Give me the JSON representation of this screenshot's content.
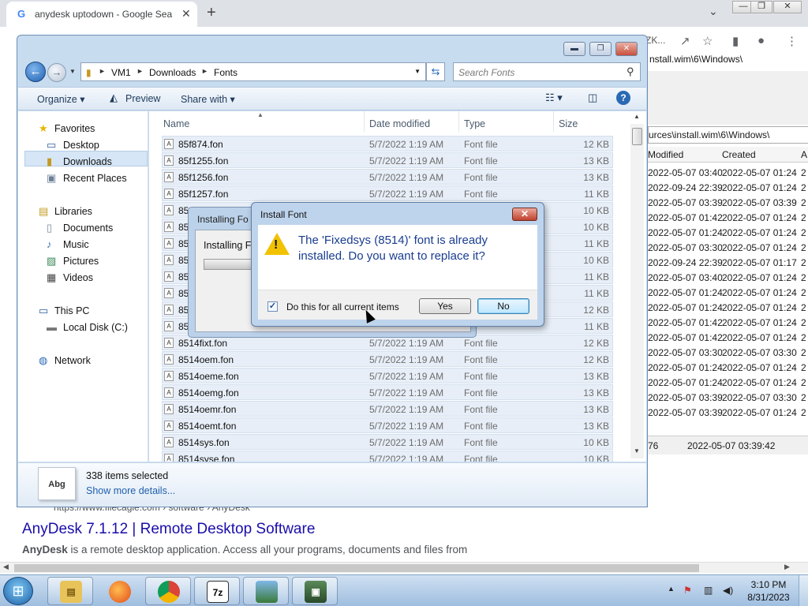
{
  "chrome": {
    "tab_title": "anydesk uptodown - Google Sea",
    "tab_close": "✕",
    "new_tab": "+",
    "tab_list": "⌄",
    "address_frag": "ZK...",
    "search_result": {
      "url": "https://www.filecagle.com › software › AnyDesk",
      "title": "AnyDesk 7.1.12 | Remote Desktop Software",
      "snippet_bold": "AnyDesk",
      "snippet": " is a remote desktop application. Access all your programs, documents and files from"
    }
  },
  "zip": {
    "path_top": "nstall.wim\\6\\Windows\\",
    "path": "urces\\install.wim\\6\\Windows\\",
    "columns": [
      "Modified",
      "Created",
      "A"
    ],
    "rows": [
      [
        "2022-05-07 03:40",
        "2022-05-07 01:24",
        "2"
      ],
      [
        "2022-09-24 22:39",
        "2022-05-07 01:24",
        "2"
      ],
      [
        "2022-05-07 03:39",
        "2022-05-07 03:39",
        "2"
      ],
      [
        "2022-05-07 01:42",
        "2022-05-07 01:24",
        "2"
      ],
      [
        "2022-05-07 01:24",
        "2022-05-07 01:24",
        "2"
      ],
      [
        "2022-05-07 03:30",
        "2022-05-07 01:24",
        "2"
      ],
      [
        "2022-09-24 22:39",
        "2022-05-07 01:17",
        "2"
      ],
      [
        "2022-05-07 03:40",
        "2022-05-07 01:24",
        "2"
      ],
      [
        "2022-05-07 01:24",
        "2022-05-07 01:24",
        "2"
      ],
      [
        "2022-05-07 01:24",
        "2022-05-07 01:24",
        "2"
      ],
      [
        "2022-05-07 01:42",
        "2022-05-07 01:24",
        "2"
      ],
      [
        "2022-05-07 01:42",
        "2022-05-07 01:24",
        "2"
      ],
      [
        "2022-05-07 03:30",
        "2022-05-07 03:30",
        "2"
      ],
      [
        "2022-05-07 01:24",
        "2022-05-07 01:24",
        "2"
      ],
      [
        "2022-05-07 01:24",
        "2022-05-07 01:24",
        "2"
      ],
      [
        "2022-05-07 03:39",
        "2022-05-07 03:30",
        "2"
      ],
      [
        "2022-05-07 03:39",
        "2022-05-07 01:24",
        "2"
      ]
    ],
    "status_left": "76",
    "status_right": "2022-05-07 03:39:42"
  },
  "explorer": {
    "breadcrumb": [
      "VM1",
      "Downloads",
      "Fonts"
    ],
    "search_placeholder": "Search Fonts",
    "toolbar": {
      "organize": "Organize",
      "preview": "Preview",
      "share_with": "Share with"
    },
    "nav": {
      "favorites": "Favorites",
      "desktop": "Desktop",
      "downloads": "Downloads",
      "recent": "Recent Places",
      "libraries": "Libraries",
      "documents": "Documents",
      "music": "Music",
      "pictures": "Pictures",
      "videos": "Videos",
      "this_pc": "This PC",
      "local_disk": "Local Disk (C:)",
      "network": "Network"
    },
    "columns": {
      "name": "Name",
      "date": "Date modified",
      "type": "Type",
      "size": "Size"
    },
    "files": [
      {
        "name": "85f874.fon",
        "date": "5/7/2022 1:19 AM",
        "type": "Font file",
        "size": "12 KB"
      },
      {
        "name": "85f1255.fon",
        "date": "5/7/2022 1:19 AM",
        "type": "Font file",
        "size": "13 KB"
      },
      {
        "name": "85f1256.fon",
        "date": "5/7/2022 1:19 AM",
        "type": "Font file",
        "size": "13 KB"
      },
      {
        "name": "85f1257.fon",
        "date": "5/7/2022 1:19 AM",
        "type": "Font file",
        "size": "11 KB"
      },
      {
        "name": "85",
        "date": "",
        "type": "",
        "size": "10 KB"
      },
      {
        "name": "85",
        "date": "",
        "type": "",
        "size": "10 KB"
      },
      {
        "name": "85",
        "date": "",
        "type": "",
        "size": "11 KB"
      },
      {
        "name": "85",
        "date": "",
        "type": "",
        "size": "10 KB"
      },
      {
        "name": "85",
        "date": "",
        "type": "",
        "size": "11 KB"
      },
      {
        "name": "85",
        "date": "",
        "type": "",
        "size": "11 KB"
      },
      {
        "name": "85",
        "date": "",
        "type": "",
        "size": "12 KB"
      },
      {
        "name": "85",
        "date": "",
        "type": "file",
        "size": "11 KB"
      },
      {
        "name": "8514fixt.fon",
        "date": "5/7/2022 1:19 AM",
        "type": "Font file",
        "size": "12 KB"
      },
      {
        "name": "8514oem.fon",
        "date": "5/7/2022 1:19 AM",
        "type": "Font file",
        "size": "12 KB"
      },
      {
        "name": "8514oeme.fon",
        "date": "5/7/2022 1:19 AM",
        "type": "Font file",
        "size": "13 KB"
      },
      {
        "name": "8514oemg.fon",
        "date": "5/7/2022 1:19 AM",
        "type": "Font file",
        "size": "13 KB"
      },
      {
        "name": "8514oemr.fon",
        "date": "5/7/2022 1:19 AM",
        "type": "Font file",
        "size": "13 KB"
      },
      {
        "name": "8514oemt.fon",
        "date": "5/7/2022 1:19 AM",
        "type": "Font file",
        "size": "13 KB"
      },
      {
        "name": "8514sys.fon",
        "date": "5/7/2022 1:19 AM",
        "type": "Font file",
        "size": "10 KB"
      },
      {
        "name": "8514syse.fon",
        "date": "5/7/2022 1:19 AM",
        "type": "Font file",
        "size": "10 KB"
      }
    ],
    "details": {
      "thumb_text": "Abg",
      "count": "338 items selected",
      "more": "Show more details..."
    }
  },
  "installing_dialog": {
    "title": "Installing Fo",
    "label": "Installing Fi"
  },
  "install_font_dialog": {
    "title": "Install Font",
    "message": "The 'Fixedsys (8514)' font is already installed. Do you want to replace it?",
    "checkbox_label": "Do this for all current items",
    "checkbox_checked": true,
    "yes": "Yes",
    "no": "No"
  },
  "taskbar": {
    "time": "3:10 PM",
    "date": "8/31/2023",
    "zip_label": "7z"
  }
}
